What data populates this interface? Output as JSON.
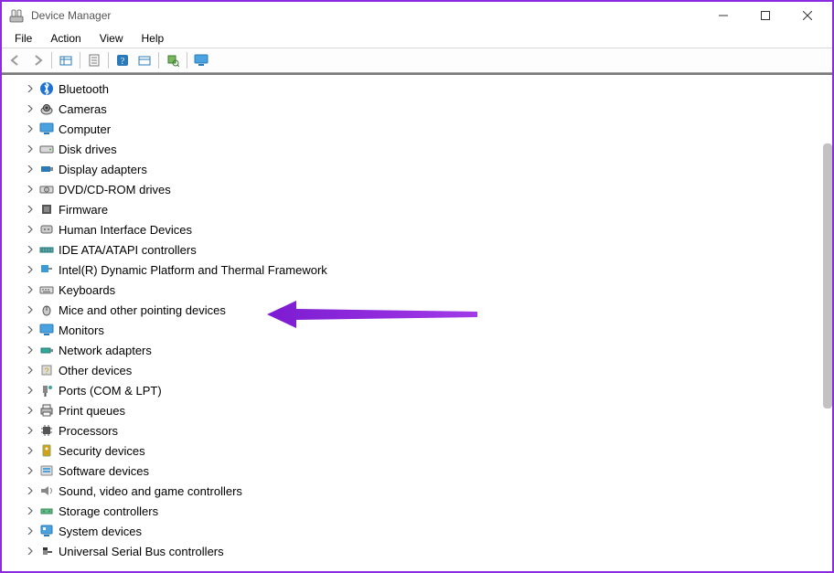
{
  "window": {
    "title": "Device Manager"
  },
  "menubar": {
    "items": [
      "File",
      "Action",
      "View",
      "Help"
    ]
  },
  "toolbar": {
    "buttons": [
      {
        "name": "back-icon"
      },
      {
        "name": "forward-icon"
      },
      {
        "sep": true
      },
      {
        "name": "show-hidden-icon"
      },
      {
        "sep": true
      },
      {
        "name": "properties-icon"
      },
      {
        "sep": true
      },
      {
        "name": "help-icon"
      },
      {
        "name": "update-driver-icon"
      },
      {
        "sep": true
      },
      {
        "name": "scan-hardware-icon"
      },
      {
        "sep": true
      },
      {
        "name": "monitor-icon"
      }
    ]
  },
  "tree": {
    "nodes": [
      {
        "label": "Bluetooth",
        "icon": "bluetooth-icon"
      },
      {
        "label": "Cameras",
        "icon": "camera-icon"
      },
      {
        "label": "Computer",
        "icon": "computer-icon"
      },
      {
        "label": "Disk drives",
        "icon": "disk-drive-icon"
      },
      {
        "label": "Display adapters",
        "icon": "display-adapter-icon"
      },
      {
        "label": "DVD/CD-ROM drives",
        "icon": "dvd-drive-icon"
      },
      {
        "label": "Firmware",
        "icon": "firmware-icon"
      },
      {
        "label": "Human Interface Devices",
        "icon": "hid-icon"
      },
      {
        "label": "IDE ATA/ATAPI controllers",
        "icon": "ide-controller-icon"
      },
      {
        "label": "Intel(R) Dynamic Platform and Thermal Framework",
        "icon": "thermal-icon"
      },
      {
        "label": "Keyboards",
        "icon": "keyboard-icon"
      },
      {
        "label": "Mice and other pointing devices",
        "icon": "mouse-icon",
        "highlight": true
      },
      {
        "label": "Monitors",
        "icon": "monitor-category-icon"
      },
      {
        "label": "Network adapters",
        "icon": "network-adapter-icon"
      },
      {
        "label": "Other devices",
        "icon": "other-device-icon"
      },
      {
        "label": "Ports (COM & LPT)",
        "icon": "port-icon"
      },
      {
        "label": "Print queues",
        "icon": "printer-icon"
      },
      {
        "label": "Processors",
        "icon": "processor-icon"
      },
      {
        "label": "Security devices",
        "icon": "security-device-icon"
      },
      {
        "label": "Software devices",
        "icon": "software-device-icon"
      },
      {
        "label": "Sound, video and game controllers",
        "icon": "sound-icon"
      },
      {
        "label": "Storage controllers",
        "icon": "storage-controller-icon"
      },
      {
        "label": "System devices",
        "icon": "system-device-icon"
      },
      {
        "label": "Universal Serial Bus controllers",
        "icon": "usb-controller-icon"
      }
    ]
  }
}
